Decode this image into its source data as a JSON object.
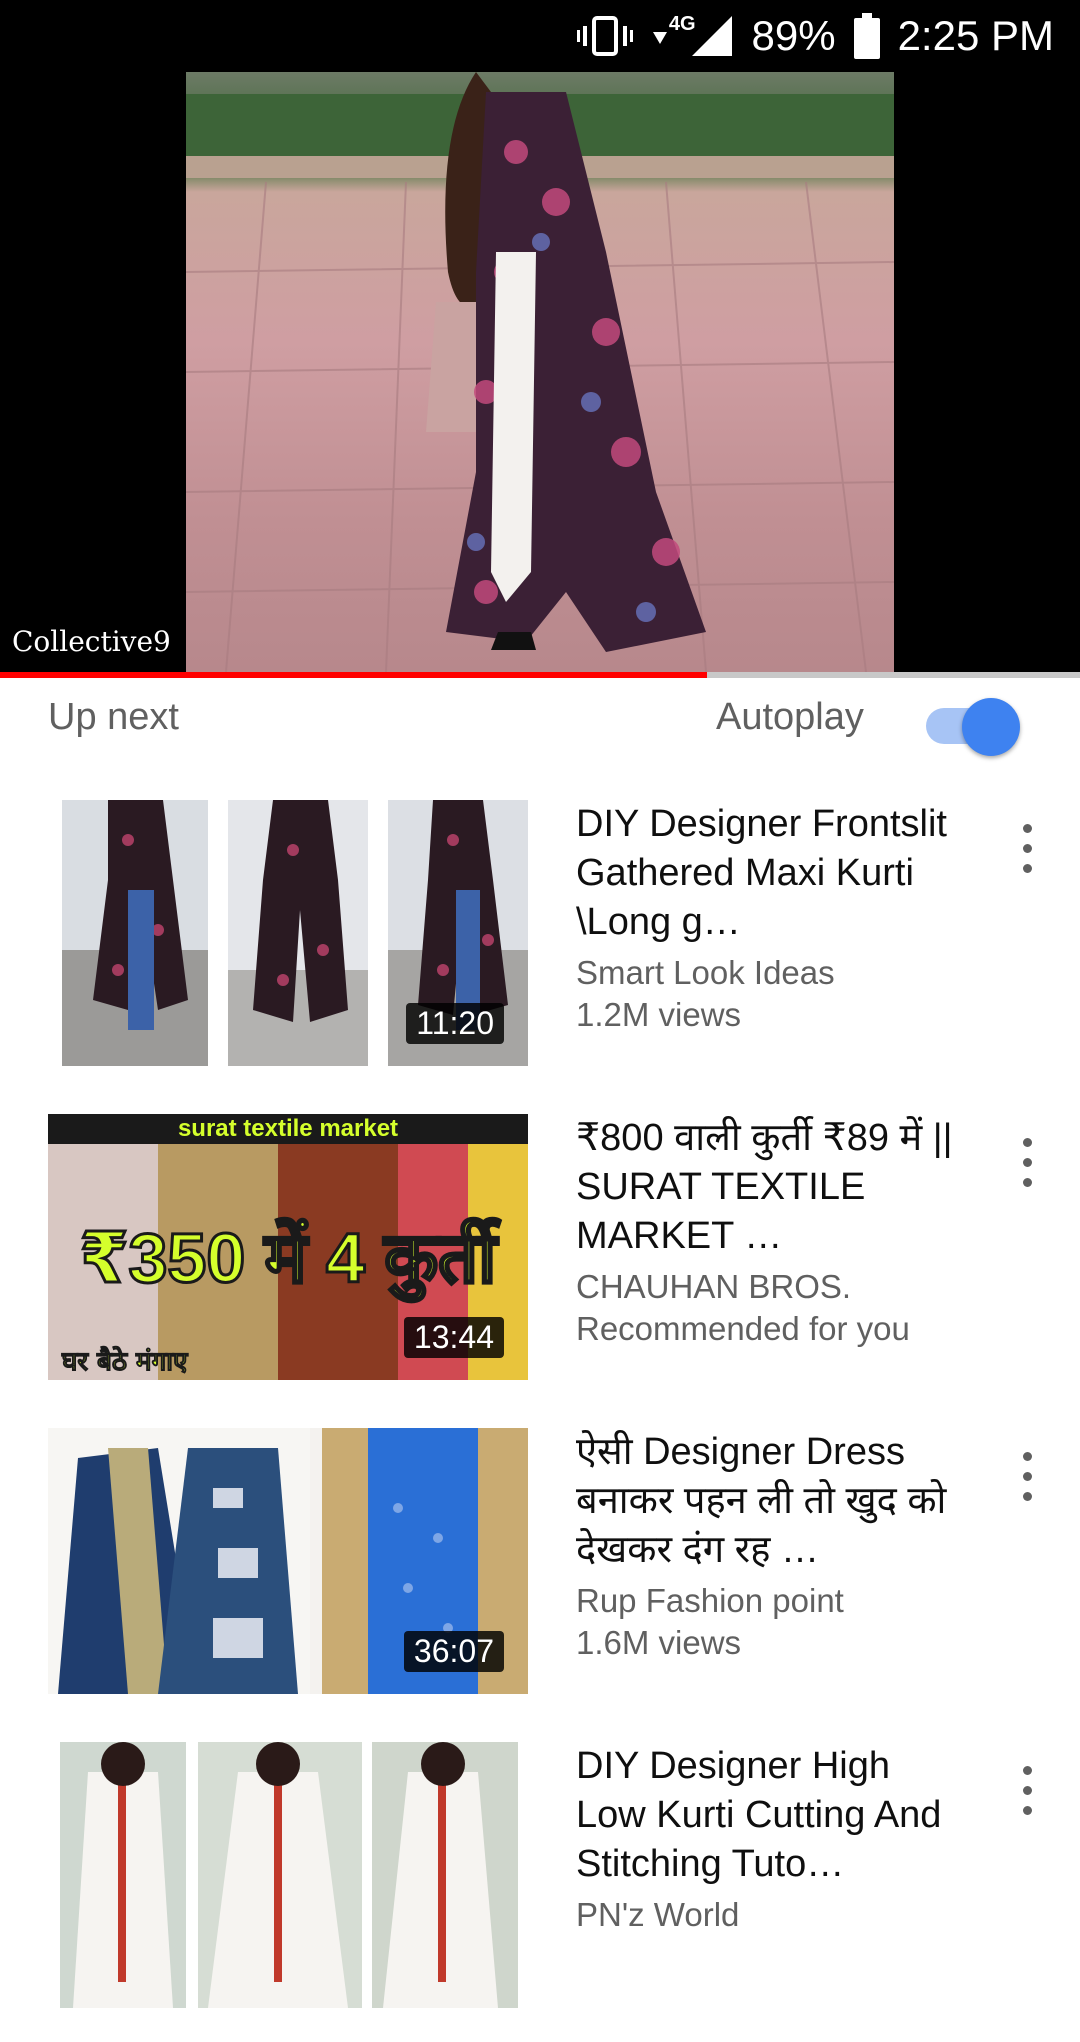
{
  "status_bar": {
    "network": "4G",
    "battery": "89%",
    "time": "2:25 PM"
  },
  "player": {
    "channel_watermark": "Collective9",
    "progress_fraction": 0.655
  },
  "up_next": {
    "label": "Up next",
    "autoplay_label": "Autoplay",
    "autoplay_on": true
  },
  "videos": [
    {
      "title": "DIY Designer Frontslit Gathered Maxi Kurti \\Long g…",
      "channel": "Smart Look Ideas",
      "stat": "1.2M views",
      "duration": "11:20"
    },
    {
      "title": "₹800 वाली कुर्ती ₹89 में || SURAT TEXTILE MARKET …",
      "channel": "CHAUHAN BROS.",
      "stat": "Recommended for you",
      "duration": "13:44",
      "thumb_banner": "surat textile market",
      "thumb_main": "₹350 में 4 कुर्ती",
      "thumb_footer": "घर बैठे मंगाए"
    },
    {
      "title": "ऐसी Designer Dress बनाकर पहन ली तो खुद को देखकर दंग रह …",
      "channel": "Rup Fashion point",
      "stat": "1.6M views",
      "duration": "36:07"
    },
    {
      "title": "DIY Designer High Low Kurti Cutting And Stitching Tuto…",
      "channel": "PN'z World",
      "stat": "",
      "duration": ""
    }
  ],
  "colors": {
    "progress_red": "#ff0000",
    "toggle_blue": "#3e82f0",
    "secondary_text": "#606060"
  }
}
